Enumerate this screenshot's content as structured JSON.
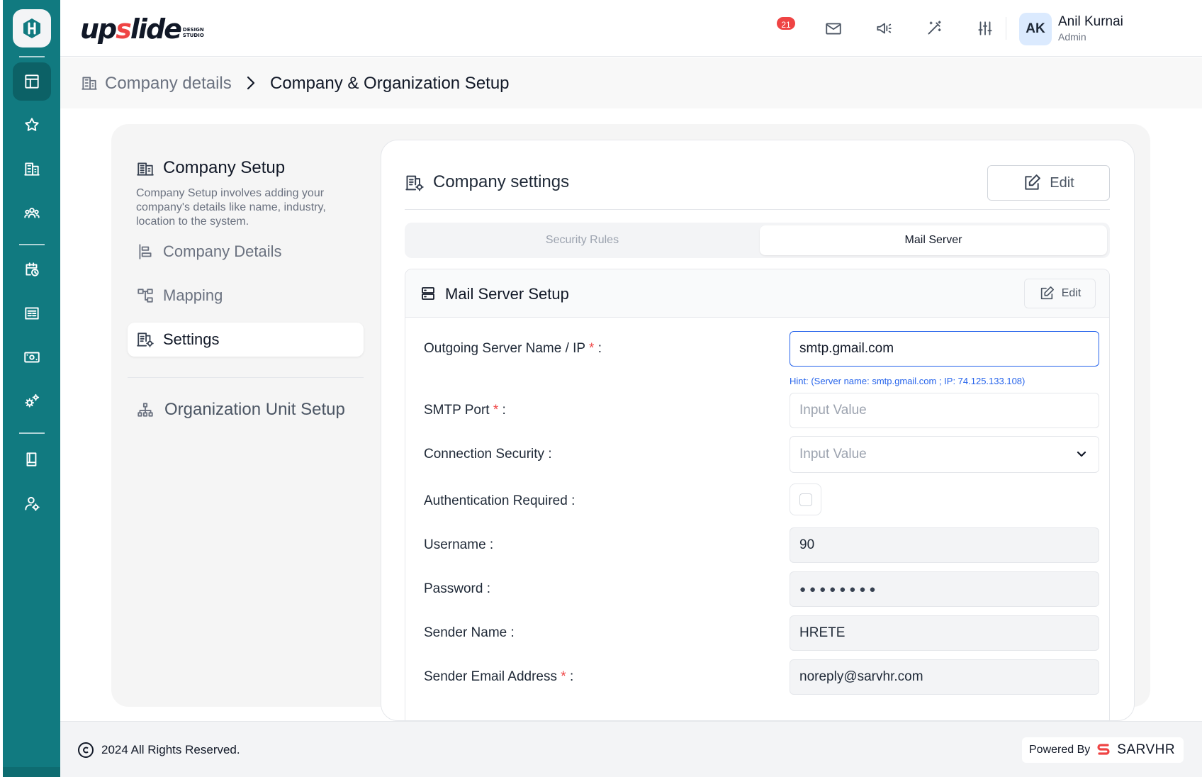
{
  "header": {
    "brand": {
      "main_a": "up",
      "main_s": "s",
      "main_b": "lide",
      "sub": "DESIGN STUDIO"
    },
    "notification_count": "21",
    "icons": [
      "mail-icon",
      "megaphone-icon",
      "magic-wand-icon",
      "sliders-icon",
      "headset-icon"
    ],
    "user": {
      "initials": "AK",
      "name": "Anil Kurnai",
      "role": "Admin"
    }
  },
  "breadcrumb": {
    "parent": "Company details",
    "current": "Company & Organization Setup"
  },
  "left_panel": {
    "title": "Company Setup",
    "description": "Company Setup involves adding your company's details like name, industry, location to the system.",
    "nav": [
      {
        "label": "Company Details",
        "icon": "align-left-icon"
      },
      {
        "label": "Mapping",
        "icon": "hierarchy-icon"
      },
      {
        "label": "Settings",
        "icon": "building-settings-icon",
        "active": true
      }
    ],
    "org_unit": {
      "label": "Organization Unit Setup",
      "icon": "org-chart-icon"
    }
  },
  "main": {
    "title": "Company settings",
    "edit_label": "Edit",
    "tabs": [
      {
        "label": "Security Rules",
        "active": false
      },
      {
        "label": "Mail Server",
        "active": true
      }
    ],
    "mail": {
      "title": "Mail Server Setup",
      "edit_label": "Edit",
      "fields": {
        "server": {
          "label": "Outgoing Server Name / IP",
          "required": "*",
          "colon": " :",
          "value": "smtp.gmail.com",
          "hint": "Hint: (Server name: smtp.gmail.com ; IP: 74.125.133.108)"
        },
        "port": {
          "label": "SMTP Port",
          "required": "*",
          "colon": " :",
          "placeholder": "Input Value"
        },
        "security": {
          "label": "Connection Security :",
          "placeholder": "Input Value"
        },
        "auth": {
          "label": "Authentication Required :",
          "checked": false
        },
        "username": {
          "label": "Username :",
          "value": "90"
        },
        "password": {
          "label": "Password :",
          "value": "●●●●●●●●"
        },
        "sender_name": {
          "label": "Sender Name :",
          "value": "HRETE"
        },
        "sender_email": {
          "label": "Sender Email Address",
          "required": "*",
          "colon": " :",
          "value": "noreply@sarvhr.com"
        }
      }
    }
  },
  "footer": {
    "copyright": "2024 All Rights Reserved.",
    "powered_by": "Powered By",
    "vendor": "SARVHR"
  },
  "colors": {
    "rail": "#117a80",
    "rail_active": "#0c6166",
    "accent_blue": "#2563eb",
    "badge_red": "#ef4444"
  }
}
